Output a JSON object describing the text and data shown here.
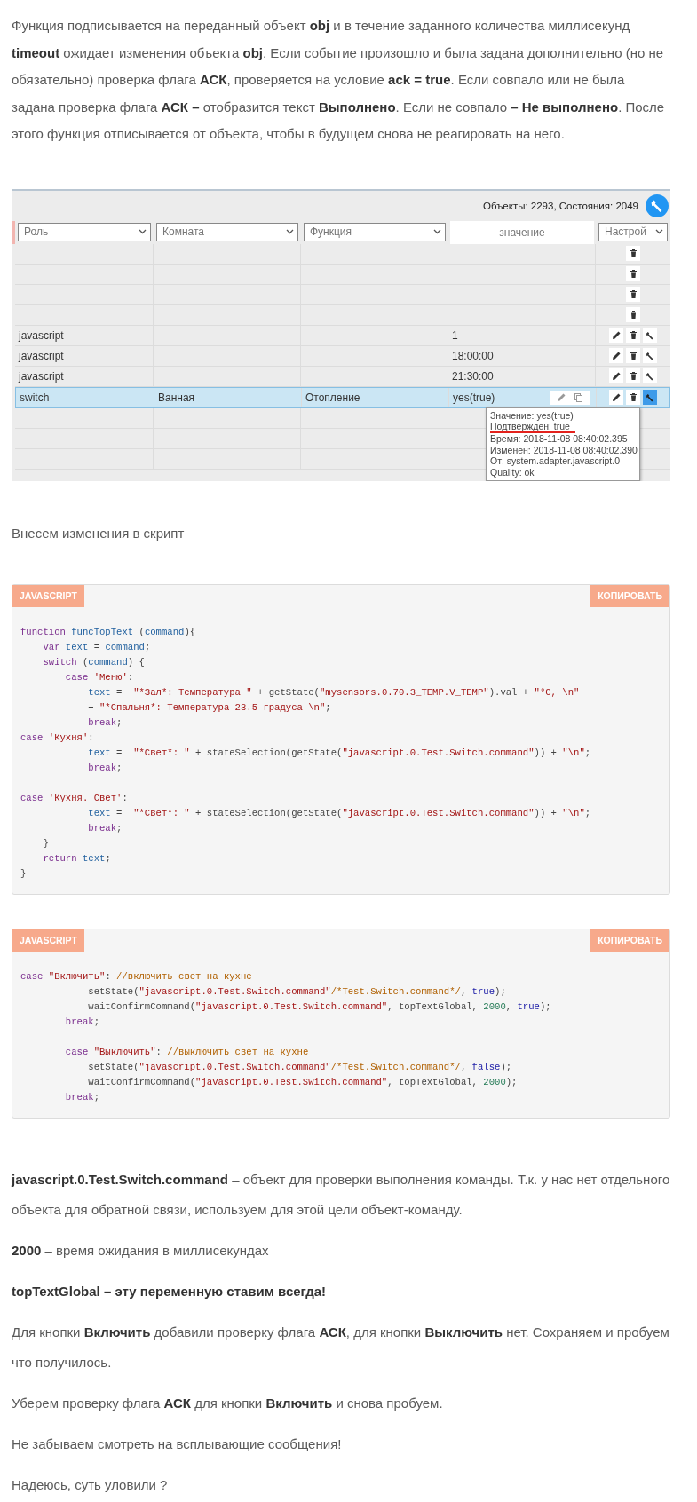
{
  "intro": "Функция подписывается на переданный объект **obj** и в течение заданного количества миллисекунд **timeout** ожидает изменения объекта **obj**. Если событие произошло и была задана дополнительно (но не обязательно) проверка флага **АСК**, проверяется на условие **ack = true**. Если совпало или не была задана проверка флага **АСК –** отобразится текст **Выполнено**. Если не совпало **– Не выполнено**. После этого функция отписывается от объекта, чтобы в будущем снова не реагировать на него.",
  "screenshot": {
    "status": "Объекты: 2293, Состояния: 2049",
    "filters": [
      {
        "kind": "select",
        "label": "Роль"
      },
      {
        "kind": "select",
        "label": "Комната"
      },
      {
        "kind": "select",
        "label": "Функция"
      },
      {
        "kind": "header",
        "label": "значение"
      },
      {
        "kind": "select",
        "label": "Настрой"
      }
    ],
    "rows": [
      {
        "kind": "trash",
        "selected": false,
        "value_tools": false
      },
      {
        "kind": "trash",
        "selected": false,
        "value_tools": false
      },
      {
        "kind": "trash",
        "selected": false,
        "value_tools": false
      },
      {
        "kind": "trash",
        "selected": false,
        "value_tools": false
      },
      {
        "kind": "full",
        "role": "javascript",
        "value": "1",
        "selected": false,
        "value_tools": false
      },
      {
        "kind": "full",
        "role": "javascript",
        "value": "18:00:00",
        "selected": false,
        "value_tools": false
      },
      {
        "kind": "full",
        "role": "javascript",
        "value": "21:30:00",
        "selected": false,
        "value_tools": false
      },
      {
        "kind": "full",
        "role": "switch",
        "room": "Ванная",
        "function": "Отопление",
        "value": "yes(true)",
        "selected": true,
        "value_tools": true
      },
      {
        "kind": "blank",
        "selected": false,
        "value_tools": false
      },
      {
        "kind": "blank",
        "selected": false,
        "value_tools": false
      },
      {
        "kind": "blank",
        "selected": false,
        "value_tools": false
      }
    ],
    "tooltip": [
      {
        "text": "Значение: yes(true)",
        "underlined": false
      },
      {
        "text": "Подтверждён: true",
        "underlined": true
      },
      {
        "text": "Время: 2018-11-08 08:40:02.395",
        "underlined": false
      },
      {
        "text": "Изменён: 2018-11-08 08:40:02.390",
        "underlined": false
      },
      {
        "text": "От: system.adapter.javascript.0",
        "underlined": false
      },
      {
        "text": "Quality: ok",
        "underlined": false
      }
    ]
  },
  "between": "Внесем изменения в скрипт",
  "code_blocks": [
    {
      "language": "JAVASCRIPT",
      "copy": "КОПИРОВАТЬ",
      "groups": [
        {
          "lines": [
            [
              {
                "kind": "kw",
                "text": "function"
              },
              {
                "kind": "id",
                "text": " funcTopText"
              },
              {
                "kind": "p",
                "text": " ("
              },
              {
                "kind": "id",
                "text": "command"
              },
              {
                "kind": "p",
                "text": "){"
              }
            ],
            [
              {
                "kind": "kw",
                "text": "    var"
              },
              {
                "kind": "id",
                "text": " text"
              },
              {
                "kind": "p",
                "text": " = "
              },
              {
                "kind": "id",
                "text": "command"
              },
              {
                "kind": "p",
                "text": ";"
              }
            ],
            [
              {
                "kind": "kw",
                "text": "    switch"
              },
              {
                "kind": "p",
                "text": " ("
              },
              {
                "kind": "id",
                "text": "command"
              },
              {
                "kind": "p",
                "text": ") {"
              }
            ],
            [
              {
                "kind": "kw",
                "text": "        case"
              },
              {
                "kind": "str",
                "text": " 'Меню'"
              },
              {
                "kind": "p",
                "text": ":"
              }
            ],
            [
              {
                "kind": "id",
                "text": "            text"
              },
              {
                "kind": "p",
                "text": " =  "
              },
              {
                "kind": "str",
                "text": "\"*Зал*: Температура \""
              },
              {
                "kind": "p",
                "text": " + getState("
              },
              {
                "kind": "str",
                "text": "\"mysensors.0.70.3_TEMP.V_TEMP\""
              },
              {
                "kind": "p",
                "text": ").val + "
              },
              {
                "kind": "str",
                "text": "\"°C, \\n\""
              }
            ],
            [
              {
                "kind": "p",
                "text": "            + "
              },
              {
                "kind": "str",
                "text": "\"*Спальня*: Температура 23.5 градуса \\n\""
              },
              {
                "kind": "p",
                "text": ";"
              }
            ],
            [
              {
                "kind": "kw",
                "text": "            break"
              },
              {
                "kind": "p",
                "text": ";"
              }
            ],
            [
              {
                "kind": "kw",
                "text": "case"
              },
              {
                "kind": "str",
                "text": " 'Кухня'"
              },
              {
                "kind": "p",
                "text": ":"
              }
            ],
            [
              {
                "kind": "id",
                "text": "            text"
              },
              {
                "kind": "p",
                "text": " =  "
              },
              {
                "kind": "str",
                "text": "\"*Свет*: \""
              },
              {
                "kind": "p",
                "text": " + stateSelection(getState("
              },
              {
                "kind": "str",
                "text": "\"javascript.0.Test.Switch.command\""
              },
              {
                "kind": "p",
                "text": ")) + "
              },
              {
                "kind": "str",
                "text": "\"\\n\""
              },
              {
                "kind": "p",
                "text": ";"
              }
            ],
            [
              {
                "kind": "kw",
                "text": "            break"
              },
              {
                "kind": "p",
                "text": ";"
              }
            ]
          ]
        },
        {
          "lines": [
            [
              {
                "kind": "kw",
                "text": "case"
              },
              {
                "kind": "str",
                "text": " 'Кухня. Свет'"
              },
              {
                "kind": "p",
                "text": ":"
              }
            ],
            [
              {
                "kind": "id",
                "text": "            text"
              },
              {
                "kind": "p",
                "text": " =  "
              },
              {
                "kind": "str",
                "text": "\"*Свет*: \""
              },
              {
                "kind": "p",
                "text": " + stateSelection(getState("
              },
              {
                "kind": "str",
                "text": "\"javascript.0.Test.Switch.command\""
              },
              {
                "kind": "p",
                "text": ")) + "
              },
              {
                "kind": "str",
                "text": "\"\\n\""
              },
              {
                "kind": "p",
                "text": ";"
              }
            ],
            [
              {
                "kind": "kw",
                "text": "            break"
              },
              {
                "kind": "p",
                "text": ";"
              }
            ],
            [
              {
                "kind": "p",
                "text": "    }"
              }
            ],
            [
              {
                "kind": "kw",
                "text": "    return"
              },
              {
                "kind": "id",
                "text": " text"
              },
              {
                "kind": "p",
                "text": ";"
              }
            ],
            [
              {
                "kind": "p",
                "text": "}"
              }
            ]
          ]
        }
      ]
    },
    {
      "language": "JAVASCRIPT",
      "copy": "КОПИРОВАТЬ",
      "groups": [
        {
          "lines": [
            [
              {
                "kind": "kw",
                "text": "case"
              },
              {
                "kind": "str",
                "text": " \"Включить\""
              },
              {
                "kind": "p",
                "text": ": "
              },
              {
                "kind": "com",
                "text": "//включить свет на кухне"
              }
            ],
            [
              {
                "kind": "p",
                "text": "            setState("
              },
              {
                "kind": "str",
                "text": "\"javascript.0.Test.Switch.command\""
              },
              {
                "kind": "com",
                "text": "/*Test.Switch.command*/"
              },
              {
                "kind": "p",
                "text": ", "
              },
              {
                "kind": "lit",
                "text": "true"
              },
              {
                "kind": "p",
                "text": ");"
              }
            ],
            [
              {
                "kind": "p",
                "text": "            waitConfirmCommand("
              },
              {
                "kind": "str",
                "text": "\"javascript.0.Test.Switch.command\""
              },
              {
                "kind": "p",
                "text": ", topTextGlobal, "
              },
              {
                "kind": "num",
                "text": "2000"
              },
              {
                "kind": "p",
                "text": ", "
              },
              {
                "kind": "lit",
                "text": "true"
              },
              {
                "kind": "p",
                "text": ");"
              }
            ],
            [
              {
                "kind": "kw",
                "text": "        break"
              },
              {
                "kind": "p",
                "text": ";"
              }
            ]
          ]
        },
        {
          "lines": [
            [
              {
                "kind": "kw",
                "text": "        case"
              },
              {
                "kind": "str",
                "text": " \"Выключить\""
              },
              {
                "kind": "p",
                "text": ": "
              },
              {
                "kind": "com",
                "text": "//выключить свет на кухне"
              }
            ],
            [
              {
                "kind": "p",
                "text": "            setState("
              },
              {
                "kind": "str",
                "text": "\"javascript.0.Test.Switch.command\""
              },
              {
                "kind": "com",
                "text": "/*Test.Switch.command*/"
              },
              {
                "kind": "p",
                "text": ", "
              },
              {
                "kind": "lit",
                "text": "false"
              },
              {
                "kind": "p",
                "text": ");"
              }
            ],
            [
              {
                "kind": "p",
                "text": "            waitConfirmCommand("
              },
              {
                "kind": "str",
                "text": "\"javascript.0.Test.Switch.command\""
              },
              {
                "kind": "p",
                "text": ", topTextGlobal, "
              },
              {
                "kind": "num",
                "text": "2000"
              },
              {
                "kind": "p",
                "text": ");"
              }
            ],
            [
              {
                "kind": "kw",
                "text": "        break"
              },
              {
                "kind": "p",
                "text": ";"
              }
            ]
          ]
        }
      ]
    }
  ],
  "paragraphs": [
    {
      "kind": "plain",
      "text": "**javascript.0.Test.Switch.command** – объект для проверки выполнения команды. Т.к. у нас нет отдельного объекта для обратной связи, используем для этой цели объект-команду."
    },
    {
      "kind": "plain",
      "text": "**2000** – время ожидания в миллисекундах"
    },
    {
      "kind": "strong",
      "text": "topTextGlobal – эту переменную ставим всегда!"
    },
    {
      "kind": "plain",
      "text": "Для кнопки **Включить** добавили проверку флага **АСК**, для кнопки **Выключить** нет. Сохраняем и пробуем что получилось."
    },
    {
      "kind": "plain",
      "text": "Уберем проверку флага **АСК** для кнопки **Включить** и снова пробуем."
    },
    {
      "kind": "plain",
      "text": "Не забываем смотреть на всплывающие сообщения!"
    },
    {
      "kind": "plain",
      "text": "Надеюсь, суть уловили ?"
    }
  ]
}
